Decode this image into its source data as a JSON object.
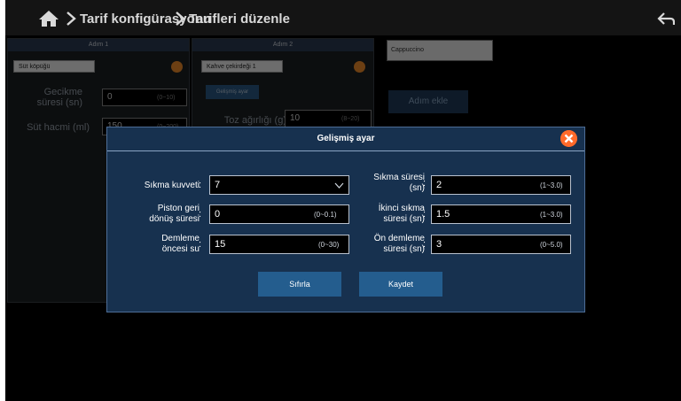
{
  "header": {
    "crumb1": "Tarif konfigürasyonu",
    "crumb2": "Tarifleri düzenle"
  },
  "background": {
    "step1": {
      "title": "Adım 1",
      "select": "Süt köpüğü",
      "delay_label_1": "Gecikme",
      "delay_label_2": "süresi (sn)",
      "delay_value": "0",
      "delay_range": "(0~10)",
      "milk_label": "Süt hacmi (ml)",
      "milk_value": "150",
      "milk_range": "(0~200)"
    },
    "step2": {
      "title": "Adım 2",
      "select": "Kahve çekirdeği 1",
      "advanced_button": "Gelişmiş ayar",
      "powder_label": "Toz ağırlığı (g)",
      "powder_value": "10",
      "powder_range": "(8~20)"
    },
    "product_name": "Cappuccino",
    "add_step_button": "Adım ekle"
  },
  "modal": {
    "title": "Gelişmiş ayar",
    "fields": [
      {
        "label_1": "Sıkma kuvveti",
        "label_2": "",
        "value": "7",
        "range": "",
        "dropdown": true
      },
      {
        "label_1": "Sıkma süresi",
        "label_2": "(sn)",
        "value": "2",
        "range": "(1~3.0)"
      },
      {
        "label_1": "Piston geri",
        "label_2": "dönüş süresi",
        "value": "0",
        "range": "(0~0.1)"
      },
      {
        "label_1": "İkinci sıkma",
        "label_2": "süresi (sn)",
        "value": "1.5",
        "range": "(1~3.0)"
      },
      {
        "label_1": "Demleme",
        "label_2": "öncesi su",
        "value": "15",
        "range": "(0~30)"
      },
      {
        "label_1": "Ön demleme",
        "label_2": "süresi (sn)",
        "value": "3",
        "range": "(0~5.0)"
      }
    ],
    "reset_button": "Sıfırla",
    "save_button": "Kaydet"
  },
  "colors": {
    "modal_bg": "#17314f",
    "button": "#245d8e",
    "close": "#ff6a2b",
    "accent_orange": "#f08c2a"
  }
}
